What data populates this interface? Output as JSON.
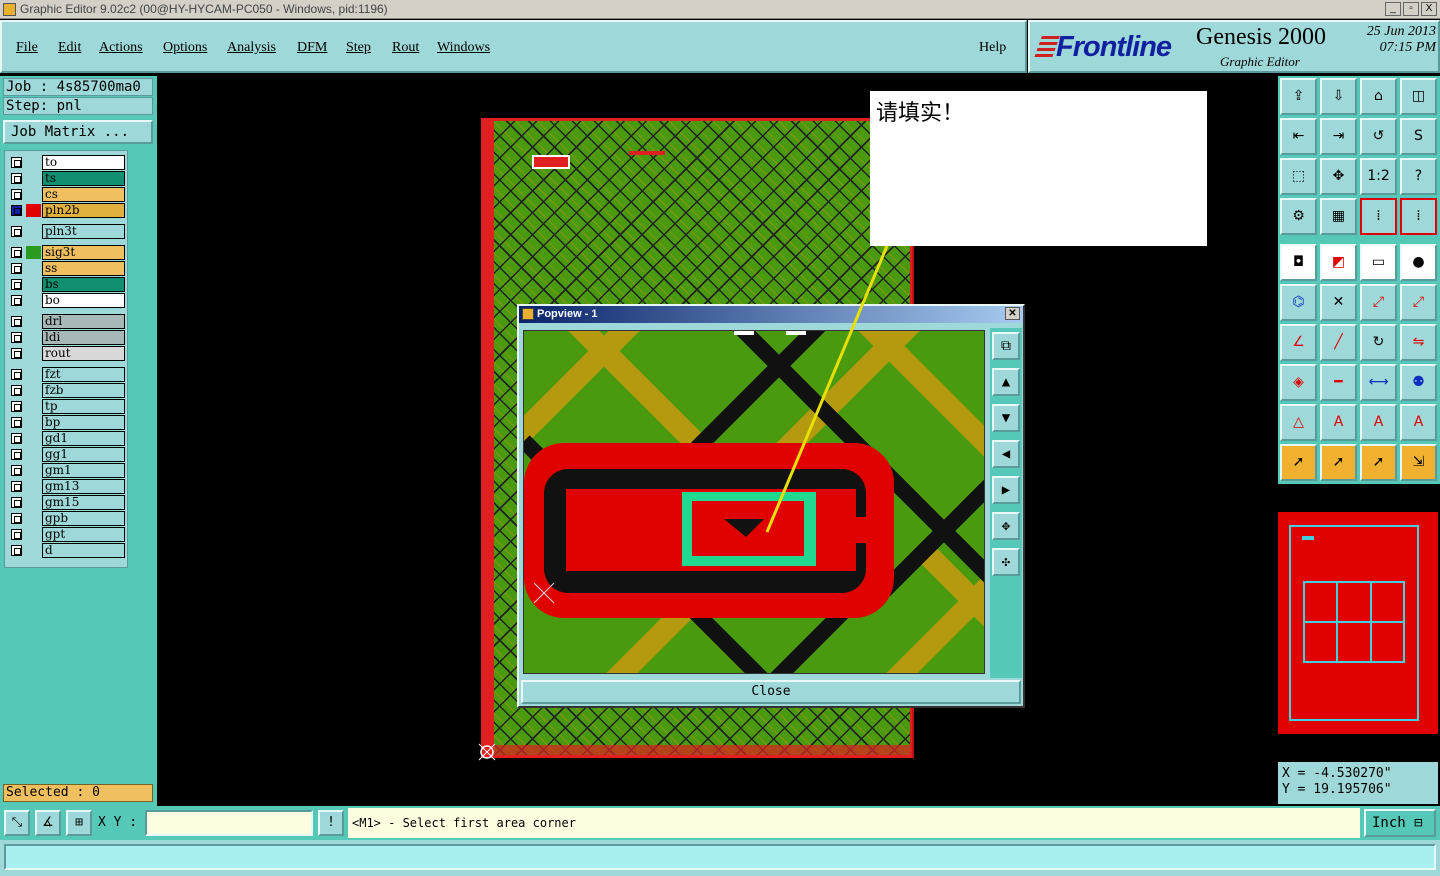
{
  "window": {
    "title": "Graphic Editor 9.02c2 (00@HY-HYCAM-PC050 - Windows, pid:1196)",
    "buttons": [
      "_",
      "▫",
      "X"
    ]
  },
  "menu": [
    "File",
    "Edit",
    "Actions",
    "Options",
    "Analysis",
    "DFM",
    "Step",
    "Rout",
    "Windows"
  ],
  "help_label": "Help",
  "brand": {
    "logo": "Frontline",
    "product": "Genesis 2000",
    "subtitle": "Graphic Editor",
    "date": "25 Jun 2013",
    "time": "07:15 PM"
  },
  "job": {
    "job_label": "Job : 4s85700ma0",
    "step_label": "Step: pnl",
    "matrix_button": "Job Matrix ..."
  },
  "layers": [
    {
      "name": "to",
      "color": "#ffffff",
      "swatch": ""
    },
    {
      "name": "ts",
      "color": "#109070",
      "swatch": ""
    },
    {
      "name": "cs",
      "color": "#f0c060",
      "swatch": ""
    },
    {
      "name": "pln2b",
      "color": "#e0b040",
      "swatch": "#e00000",
      "active": true
    },
    {
      "name": "pln3t",
      "color": "#9fd8d8",
      "swatch": ""
    },
    {
      "name": "sig3t",
      "color": "#f0c060",
      "swatch": "#2a9a20"
    },
    {
      "name": "ss",
      "color": "#f0c060",
      "swatch": ""
    },
    {
      "name": "bs",
      "color": "#109070",
      "swatch": ""
    },
    {
      "name": "bo",
      "color": "#ffffff",
      "swatch": ""
    },
    {
      "name": "drl",
      "color": "#a8b8b8",
      "swatch": ""
    },
    {
      "name": "ldi",
      "color": "#a8b8b8",
      "swatch": ""
    },
    {
      "name": "rout",
      "color": "#d8d8d8",
      "swatch": ""
    },
    {
      "name": "fzt",
      "color": "#9fd8d8",
      "swatch": ""
    },
    {
      "name": "fzb",
      "color": "#9fd8d8",
      "swatch": ""
    },
    {
      "name": "tp",
      "color": "#9fd8d8",
      "swatch": ""
    },
    {
      "name": "bp",
      "color": "#9fd8d8",
      "swatch": ""
    },
    {
      "name": "gd1",
      "color": "#9fd8d8",
      "swatch": ""
    },
    {
      "name": "gg1",
      "color": "#9fd8d8",
      "swatch": ""
    },
    {
      "name": "gm1",
      "color": "#9fd8d8",
      "swatch": ""
    },
    {
      "name": "gm13",
      "color": "#9fd8d8",
      "swatch": ""
    },
    {
      "name": "gm15",
      "color": "#9fd8d8",
      "swatch": ""
    },
    {
      "name": "gpb",
      "color": "#9fd8d8",
      "swatch": ""
    },
    {
      "name": "gpt",
      "color": "#9fd8d8",
      "swatch": ""
    },
    {
      "name": "d",
      "color": "#9fd8d8",
      "swatch": ""
    }
  ],
  "selected_label": "Selected : 0",
  "note_text": "请填实！",
  "popview": {
    "title": "Popview - 1",
    "close_label": "Close"
  },
  "coords": {
    "x": "X = -4.530270\"",
    "y": "Y = 19.195706\""
  },
  "bottom": {
    "xy_label": "X Y :",
    "xy_value": "",
    "prompt": "<M1> - Select first area corner",
    "units": "Inch",
    "mark": "!"
  },
  "colors": {
    "panel": "#9fd8d8",
    "teal": "#55c8b8",
    "copper_green": "#4a9a10",
    "feature_red": "#e00000",
    "highlight_green": "#20d890"
  }
}
